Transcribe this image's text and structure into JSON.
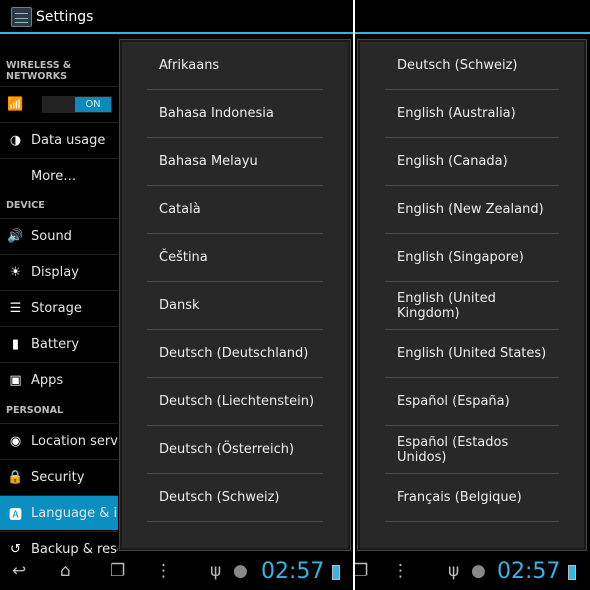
{
  "left": {
    "title": "Settings",
    "sidebar": {
      "wireless_header": "WIRELESS & NETWORKS",
      "wifi_toggle": "ON",
      "data_usage": "Data usage",
      "more": "More…",
      "device_header": "DEVICE",
      "sound": "Sound",
      "display": "Display",
      "storage": "Storage",
      "battery": "Battery",
      "apps": "Apps",
      "personal_header": "PERSONAL",
      "location": "Location services",
      "security": "Security",
      "language": "Language & input",
      "backup": "Backup & reset"
    },
    "languages": [
      "Afrikaans",
      "Bahasa Indonesia",
      "Bahasa Melayu",
      "Català",
      "Čeština",
      "Dansk",
      "Deutsch (Deutschland)",
      "Deutsch (Liechtenstein)",
      "Deutsch (Österreich)",
      "Deutsch (Schweiz)"
    ],
    "clock": "02:57"
  },
  "right": {
    "languages": [
      "Deutsch (Schweiz)",
      "English (Australia)",
      "English (Canada)",
      "English (New Zealand)",
      "English (Singapore)",
      "English (United Kingdom)",
      "English (United States)",
      "Español (España)",
      "Español (Estados Unidos)",
      "Français (Belgique)"
    ],
    "clock": "02:57"
  },
  "colors": {
    "accent": "#33b5e5",
    "selected": "#0a8fc0",
    "dialog": "#282828"
  }
}
